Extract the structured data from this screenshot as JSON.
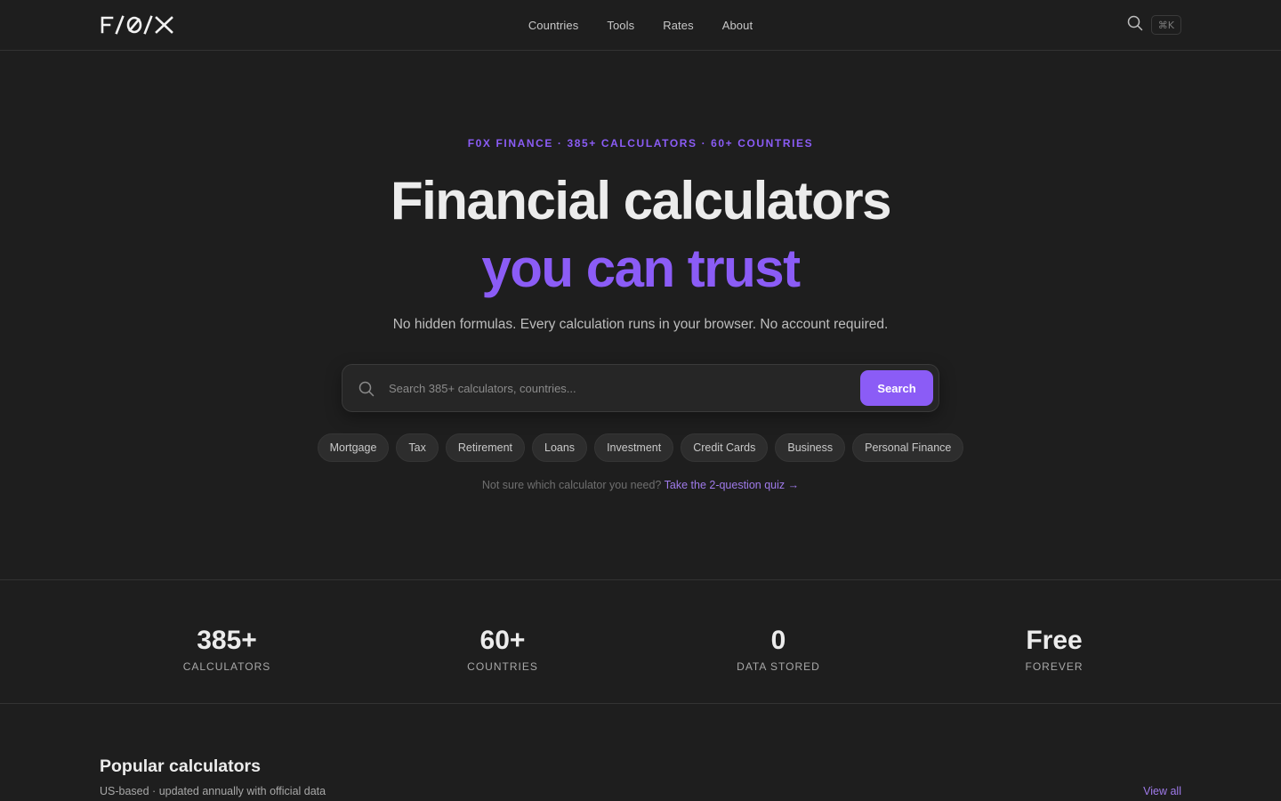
{
  "brand": {
    "logo_text": "F/Ø/X"
  },
  "nav": {
    "items": [
      "Countries",
      "Tools",
      "Rates",
      "About"
    ]
  },
  "header": {
    "shortcut": "⌘K"
  },
  "hero": {
    "eyebrow": "F0X FINANCE · 385+ CALCULATORS · 60+ COUNTRIES",
    "title_line1": "Financial calculators",
    "title_line2": "you can trust",
    "subtitle": "No hidden formulas. Every calculation runs in your browser. No account required."
  },
  "search": {
    "placeholder": "Search 385+ calculators, countries...",
    "value": "",
    "button_label": "Search"
  },
  "categories": [
    "Mortgage",
    "Tax",
    "Retirement",
    "Loans",
    "Investment",
    "Credit Cards",
    "Business",
    "Personal Finance"
  ],
  "quiz": {
    "prompt": "Not sure which calculator you need?",
    "link_label": "Take the 2-question quiz →"
  },
  "stats": [
    {
      "value": "385+",
      "label": "CALCULATORS"
    },
    {
      "value": "60+",
      "label": "COUNTRIES"
    },
    {
      "value": "0",
      "label": "DATA STORED"
    },
    {
      "value": "Free",
      "label": "FOREVER"
    }
  ],
  "popular": {
    "title": "Popular calculators",
    "subtitle": "US-based · updated annually with official data",
    "view_all": "View all"
  },
  "colors": {
    "accent": "#8b5cf6",
    "background": "#1e1e1e",
    "text": "#ececec"
  }
}
